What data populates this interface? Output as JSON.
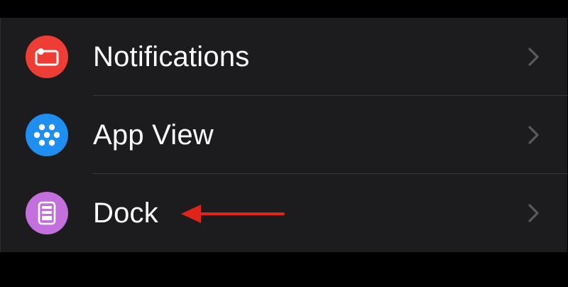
{
  "colors": {
    "background": "#000000",
    "group_background": "#1c1c1e",
    "separator": "#38383a",
    "label_text": "#ffffff",
    "chevron": "#5a5a5e",
    "annotation_arrow": "#e0241b"
  },
  "settings": {
    "items": [
      {
        "label": "Notifications",
        "icon": "notifications-icon",
        "icon_color": "#ee3d34"
      },
      {
        "label": "App View",
        "icon": "app-view-icon",
        "icon_color": "#1e8ff0"
      },
      {
        "label": "Dock",
        "icon": "dock-icon",
        "icon_color": "#c36fde"
      }
    ],
    "chevron_icon": "chevron-right-icon"
  },
  "annotation": {
    "type": "arrow",
    "points_to": "Dock"
  }
}
